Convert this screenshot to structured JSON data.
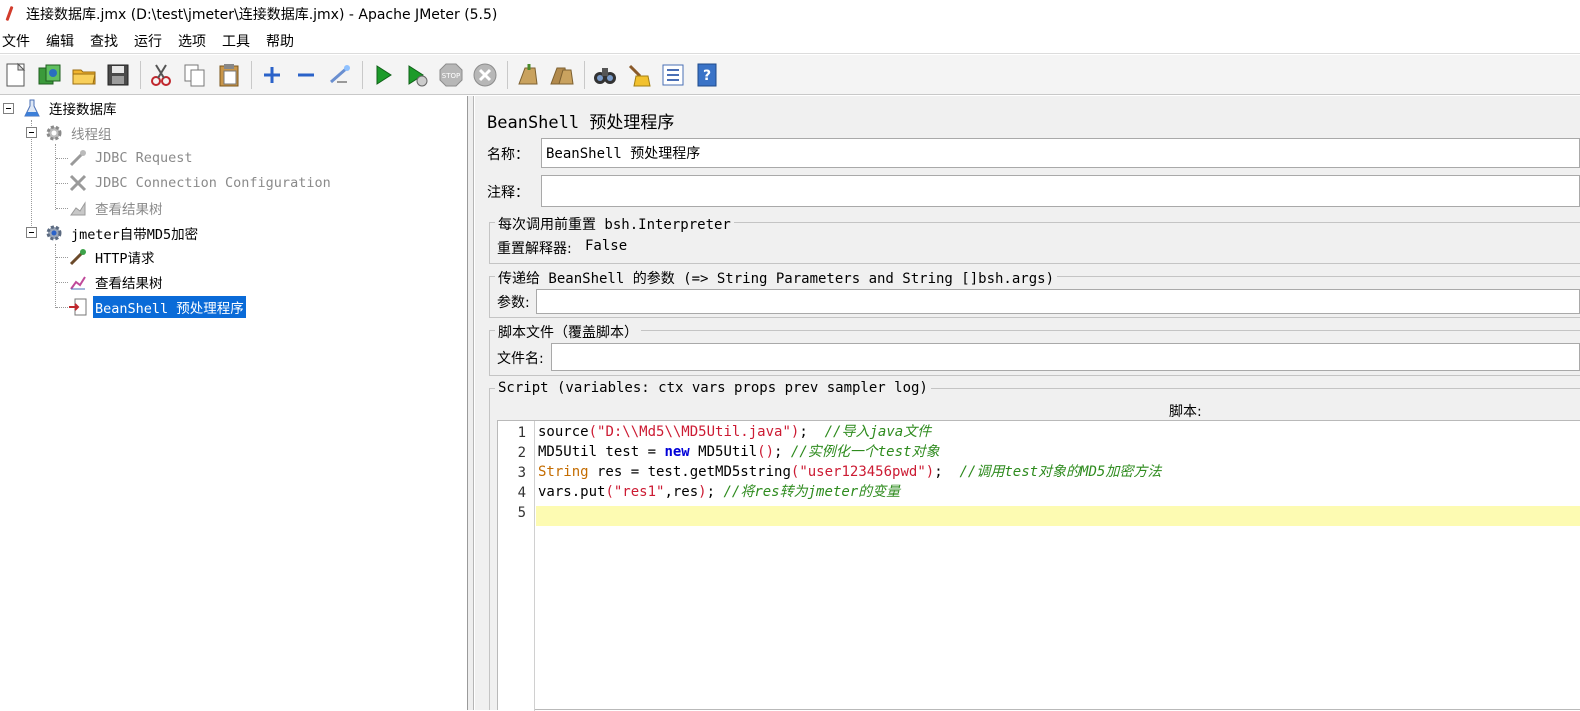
{
  "window": {
    "title": "连接数据库.jmx (D:\\test\\jmeter\\连接数据库.jmx) - Apache JMeter (5.5)"
  },
  "menu": {
    "items": [
      "文件",
      "编辑",
      "查找",
      "运行",
      "选项",
      "工具",
      "帮助"
    ]
  },
  "toolbar": {
    "buttons": [
      "new-icon",
      "templates-icon",
      "open-icon",
      "save-icon",
      "cut-icon",
      "copy-icon",
      "paste-icon",
      "expand-icon",
      "collapse-icon",
      "toggle-icon",
      "start-icon",
      "start-no-pauses-icon",
      "stop-icon",
      "shutdown-icon",
      "clear-icon",
      "clear-all-icon",
      "search-icon",
      "reset-search-icon",
      "function-helper-icon",
      "help-icon"
    ]
  },
  "tree": {
    "nodes": [
      {
        "label": "连接数据库",
        "icon": "test-plan-icon",
        "state": "normal"
      },
      {
        "label": "线程组",
        "icon": "gear-icon",
        "state": "disabled"
      },
      {
        "label": "JDBC Request",
        "icon": "sampler-icon",
        "state": "disabled"
      },
      {
        "label": "JDBC Connection Configuration",
        "icon": "config-icon",
        "state": "disabled"
      },
      {
        "label": "查看结果树",
        "icon": "listener-icon",
        "state": "disabled"
      },
      {
        "label": "jmeter自带MD5加密",
        "icon": "gear-icon",
        "state": "normal"
      },
      {
        "label": "HTTP请求",
        "icon": "sampler-icon",
        "state": "normal"
      },
      {
        "label": "查看结果树",
        "icon": "listener-icon",
        "state": "normal"
      },
      {
        "label": "BeanShell 预处理程序",
        "icon": "preprocessor-icon",
        "state": "selected"
      }
    ]
  },
  "panel": {
    "title": "BeanShell 预处理程序",
    "name_label": "名称：",
    "name_value": "BeanShell 预处理程序",
    "comment_label": "注释：",
    "comment_value": "",
    "reset_group": {
      "legend": "每次调用前重置 bsh.Interpreter",
      "label": "重置解释器:",
      "value": "False"
    },
    "params_group": {
      "legend": "传递给 BeanShell 的参数 (=> String Parameters and String []bsh.args)",
      "label": "参数:",
      "value": ""
    },
    "file_group": {
      "legend": "脚本文件（覆盖脚本）",
      "label": "文件名:",
      "value": ""
    },
    "script_group": {
      "legend": "Script (variables: ctx vars props prev sampler log)",
      "label": "脚本:"
    }
  },
  "script": {
    "line_numbers": [
      "1",
      "2",
      "3",
      "4",
      "5"
    ],
    "lines": [
      [
        {
          "t": "source",
          "c": ""
        },
        {
          "t": "(",
          "c": "paren"
        },
        {
          "t": "\"D:\\\\Md5\\\\MD5Util.java\"",
          "c": "str"
        },
        {
          "t": ")",
          "c": "paren"
        },
        {
          "t": ";  ",
          "c": ""
        },
        {
          "t": "//导入java文件",
          "c": "cm"
        }
      ],
      [
        {
          "t": "MD5Util test = ",
          "c": ""
        },
        {
          "t": "new",
          "c": "kw"
        },
        {
          "t": " MD5Util",
          "c": ""
        },
        {
          "t": "()",
          "c": "paren"
        },
        {
          "t": "; ",
          "c": ""
        },
        {
          "t": "//实例化一个test对象",
          "c": "cm"
        }
      ],
      [
        {
          "t": "String",
          "c": "ty"
        },
        {
          "t": " res = test.getMD5string",
          "c": ""
        },
        {
          "t": "(",
          "c": "paren"
        },
        {
          "t": "\"user123456pwd\"",
          "c": "str"
        },
        {
          "t": ")",
          "c": "paren"
        },
        {
          "t": ";  ",
          "c": ""
        },
        {
          "t": "//调用test对象的MD5加密方法",
          "c": "cm"
        }
      ],
      [
        {
          "t": "vars.put",
          "c": ""
        },
        {
          "t": "(",
          "c": "paren"
        },
        {
          "t": "\"res1\"",
          "c": "str"
        },
        {
          "t": ",res",
          "c": ""
        },
        {
          "t": ")",
          "c": "paren"
        },
        {
          "t": "; ",
          "c": ""
        },
        {
          "t": "//将res转为jmeter的变量",
          "c": "cm"
        }
      ],
      []
    ]
  }
}
